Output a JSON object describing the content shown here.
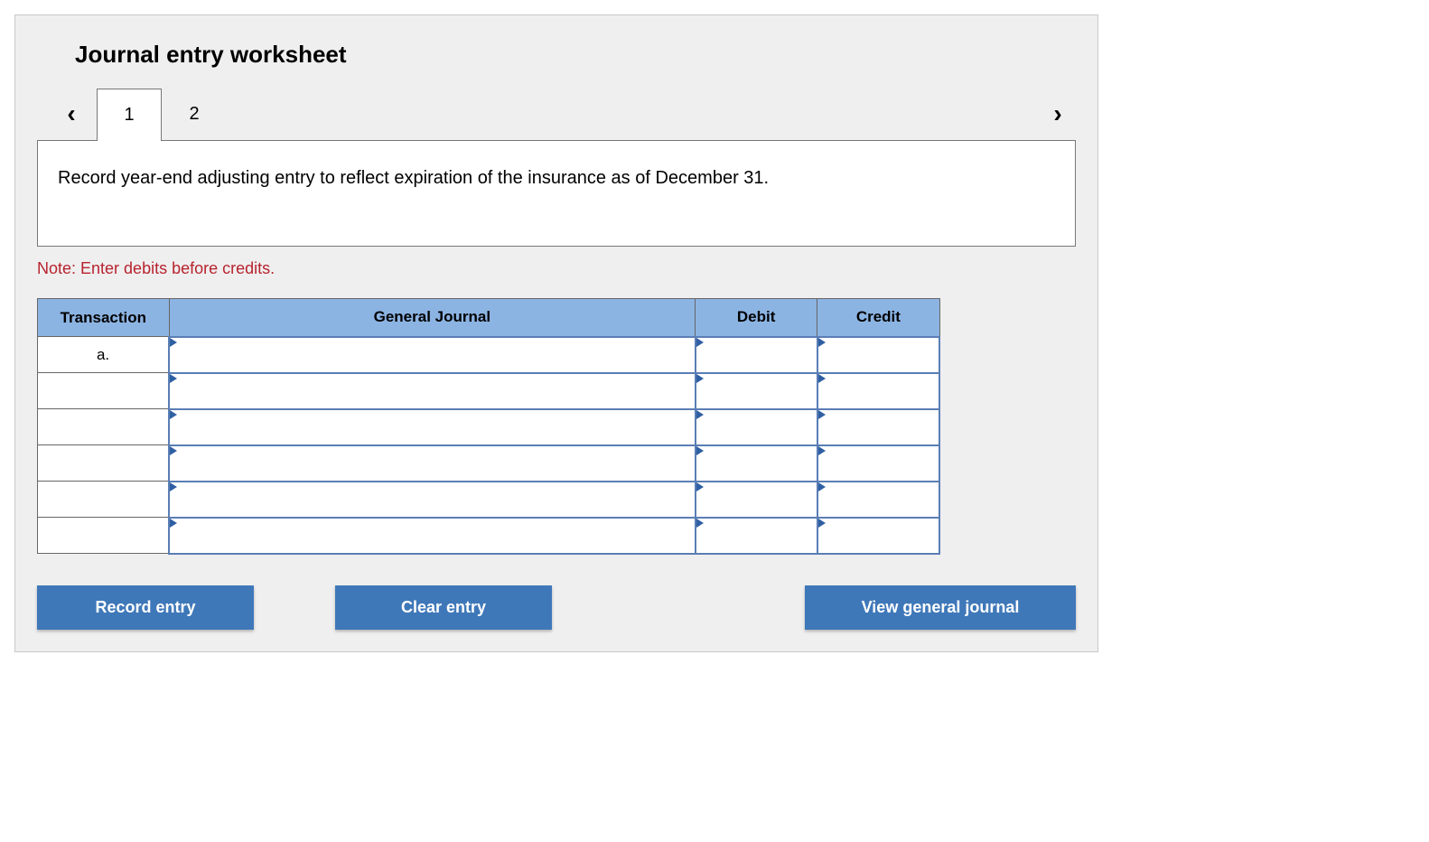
{
  "title": "Journal entry worksheet",
  "nav": {
    "prev_glyph": "‹",
    "next_glyph": "›"
  },
  "tabs": [
    {
      "label": "1",
      "active": true
    },
    {
      "label": "2",
      "active": false
    }
  ],
  "description": "Record year-end adjusting entry to reflect expiration of the insurance as of December 31.",
  "note": "Note: Enter debits before credits.",
  "table": {
    "headers": {
      "transaction": "Transaction",
      "general_journal": "General Journal",
      "debit": "Debit",
      "credit": "Credit"
    },
    "rows": [
      {
        "transaction": "a.",
        "general_journal": "",
        "debit": "",
        "credit": ""
      },
      {
        "transaction": "",
        "general_journal": "",
        "debit": "",
        "credit": ""
      },
      {
        "transaction": "",
        "general_journal": "",
        "debit": "",
        "credit": ""
      },
      {
        "transaction": "",
        "general_journal": "",
        "debit": "",
        "credit": ""
      },
      {
        "transaction": "",
        "general_journal": "",
        "debit": "",
        "credit": ""
      },
      {
        "transaction": "",
        "general_journal": "",
        "debit": "",
        "credit": ""
      }
    ]
  },
  "buttons": {
    "record": "Record entry",
    "clear": "Clear entry",
    "view_journal": "View general journal"
  }
}
